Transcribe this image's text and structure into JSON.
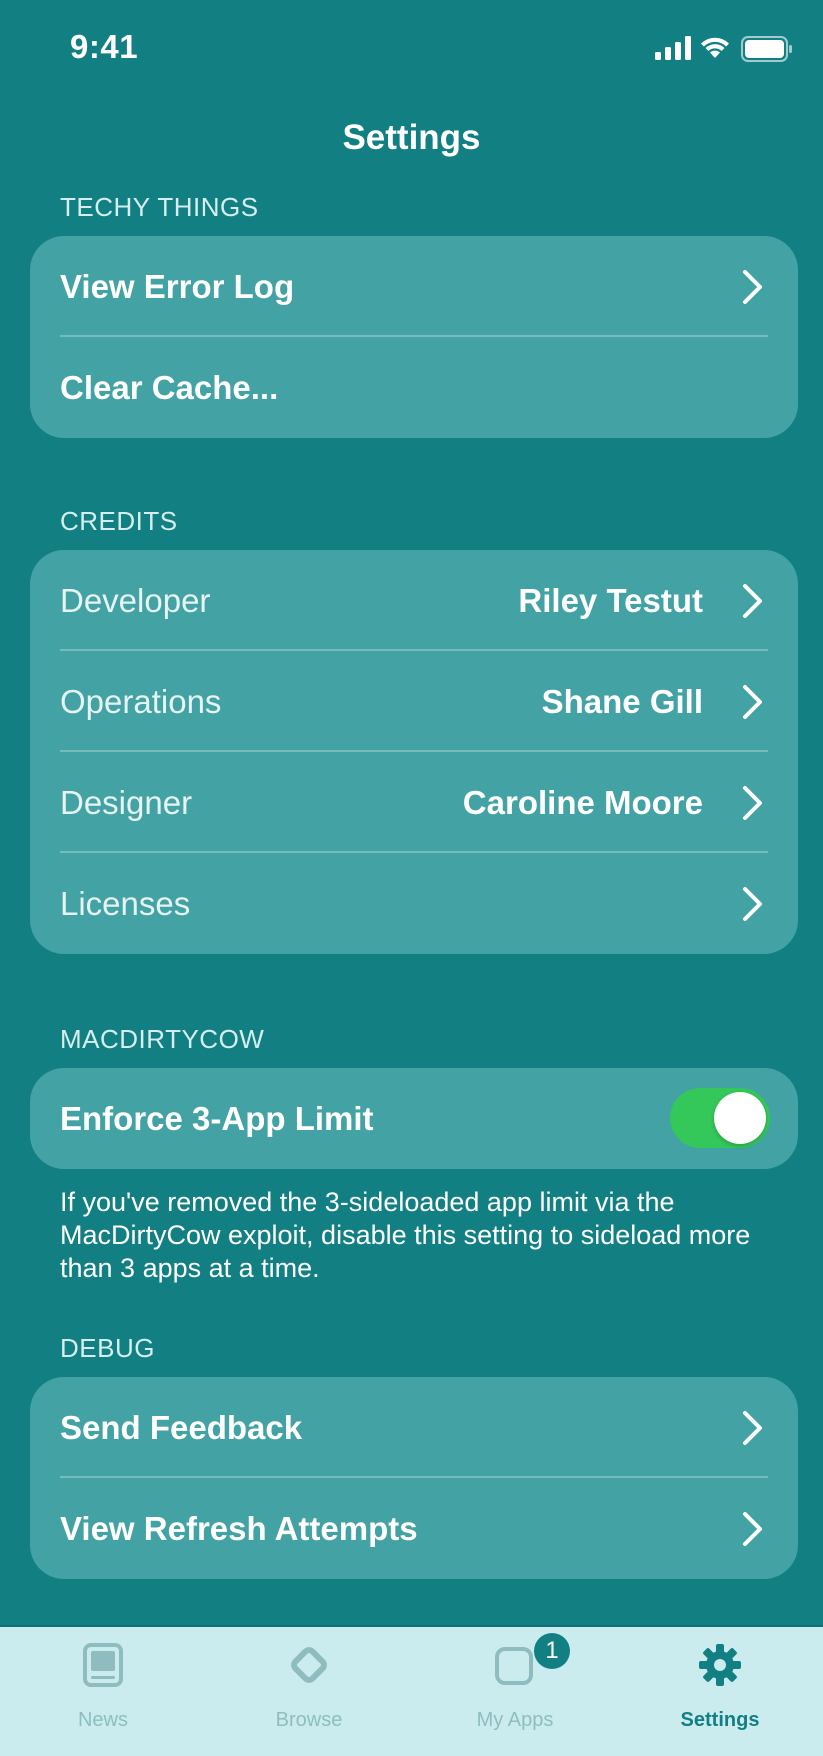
{
  "status_bar": {
    "time": "9:41"
  },
  "nav": {
    "title": "Settings"
  },
  "sections": {
    "techy": {
      "header": "TECHY THINGS",
      "view_error_log": "View Error Log",
      "clear_cache": "Clear Cache..."
    },
    "credits": {
      "header": "CREDITS",
      "developer_label": "Developer",
      "developer_value": "Riley Testut",
      "operations_label": "Operations",
      "operations_value": "Shane Gill",
      "designer_label": "Designer",
      "designer_value": "Caroline Moore",
      "licenses_label": "Licenses"
    },
    "macdirtycow": {
      "header": "MACDIRTYCOW",
      "enforce_label": "Enforce 3-App Limit",
      "enforce_enabled": true,
      "footer": "If you've removed the 3-sideloaded app limit via the MacDirtyCow exploit, disable this setting to sideload more than 3 apps at a time."
    },
    "debug": {
      "header": "DEBUG",
      "send_feedback": "Send Feedback",
      "view_refresh_attempts": "View Refresh Attempts"
    }
  },
  "tab_bar": {
    "news": "News",
    "browse": "Browse",
    "my_apps": "My Apps",
    "my_apps_badge": "1",
    "settings": "Settings"
  },
  "colors": {
    "background": "#127f83",
    "group": "#43a2a4",
    "toggle_on": "#34c759",
    "tab_bar": "#cbecee"
  }
}
